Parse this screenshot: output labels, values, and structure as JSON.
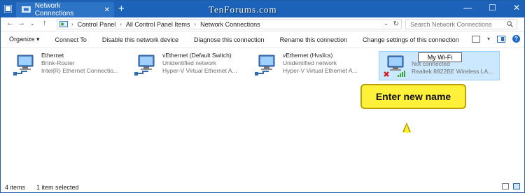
{
  "window": {
    "tab_title": "Network Connections",
    "tab_close": "✕",
    "new_tab": "+",
    "watermark": "TenForums.com",
    "controls": [
      "—",
      "☐",
      "✕"
    ]
  },
  "address": {
    "crumbs": [
      "Control Panel",
      "All Control Panel Items",
      "Network Connections"
    ],
    "search_placeholder": "Search Network Connections"
  },
  "toolbar": {
    "organize": "Organize ▾",
    "connect_to": "Connect To",
    "disable": "Disable this network device",
    "diagnose": "Diagnose this connection",
    "rename": "Rename this connection",
    "change_settings": "Change settings of this connection"
  },
  "connections": [
    {
      "name": "Ethernet",
      "status": "Brink-Router",
      "device": "Intel(R) Ethernet Connectio..."
    },
    {
      "name": "vEthernet (Default Switch)",
      "status": "Unidentified network",
      "device": "Hyper-V Virtual Ethernet A..."
    },
    {
      "name": "vEthernet (Hvsilcs)",
      "status": "Unidentified network",
      "device": "Hyper-V Virtual Ethernet A..."
    },
    {
      "name": "My Wi-Fi",
      "status": "Not connected",
      "device": "Realtek 8822BE Wireless LA..."
    }
  ],
  "callout": {
    "text": "Enter new name"
  },
  "status": {
    "count": "4 items",
    "selected": "1 item selected"
  },
  "colors": {
    "titlebar": "#1c62b8",
    "selection": "#cce8ff",
    "callout": "#fff13a"
  }
}
